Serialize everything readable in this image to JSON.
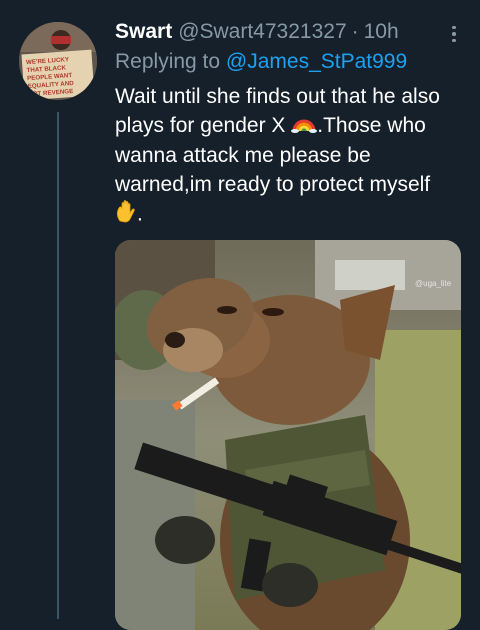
{
  "tweet": {
    "author_name": "Swart",
    "author_handle": "@Swart47321327",
    "separator": "·",
    "time": "10h",
    "replying_prefix": "Replying to ",
    "replying_handle": "@James_StPat999",
    "text_part1": "Wait until she finds out that he also plays for  gender X ",
    "text_part2": ".Those who wanna attack me please be warned,im ready to protect myself ",
    "text_part3": ".",
    "emoji_1": "rainbow-emoji",
    "emoji_2": "raised-hand-emoji"
  },
  "avatar": {
    "sign_text": "WE'RE LUCKY THAT BLACK PEOPLE WANT EQUALITY AND NOT REVENGE"
  },
  "media": {
    "description": "dog-with-rifle-photo",
    "watermark": "@uga_lite"
  },
  "colors": {
    "background": "#15202b",
    "link": "#1da1f2",
    "secondary": "#8899a6",
    "thread_line": "#3d5466"
  }
}
